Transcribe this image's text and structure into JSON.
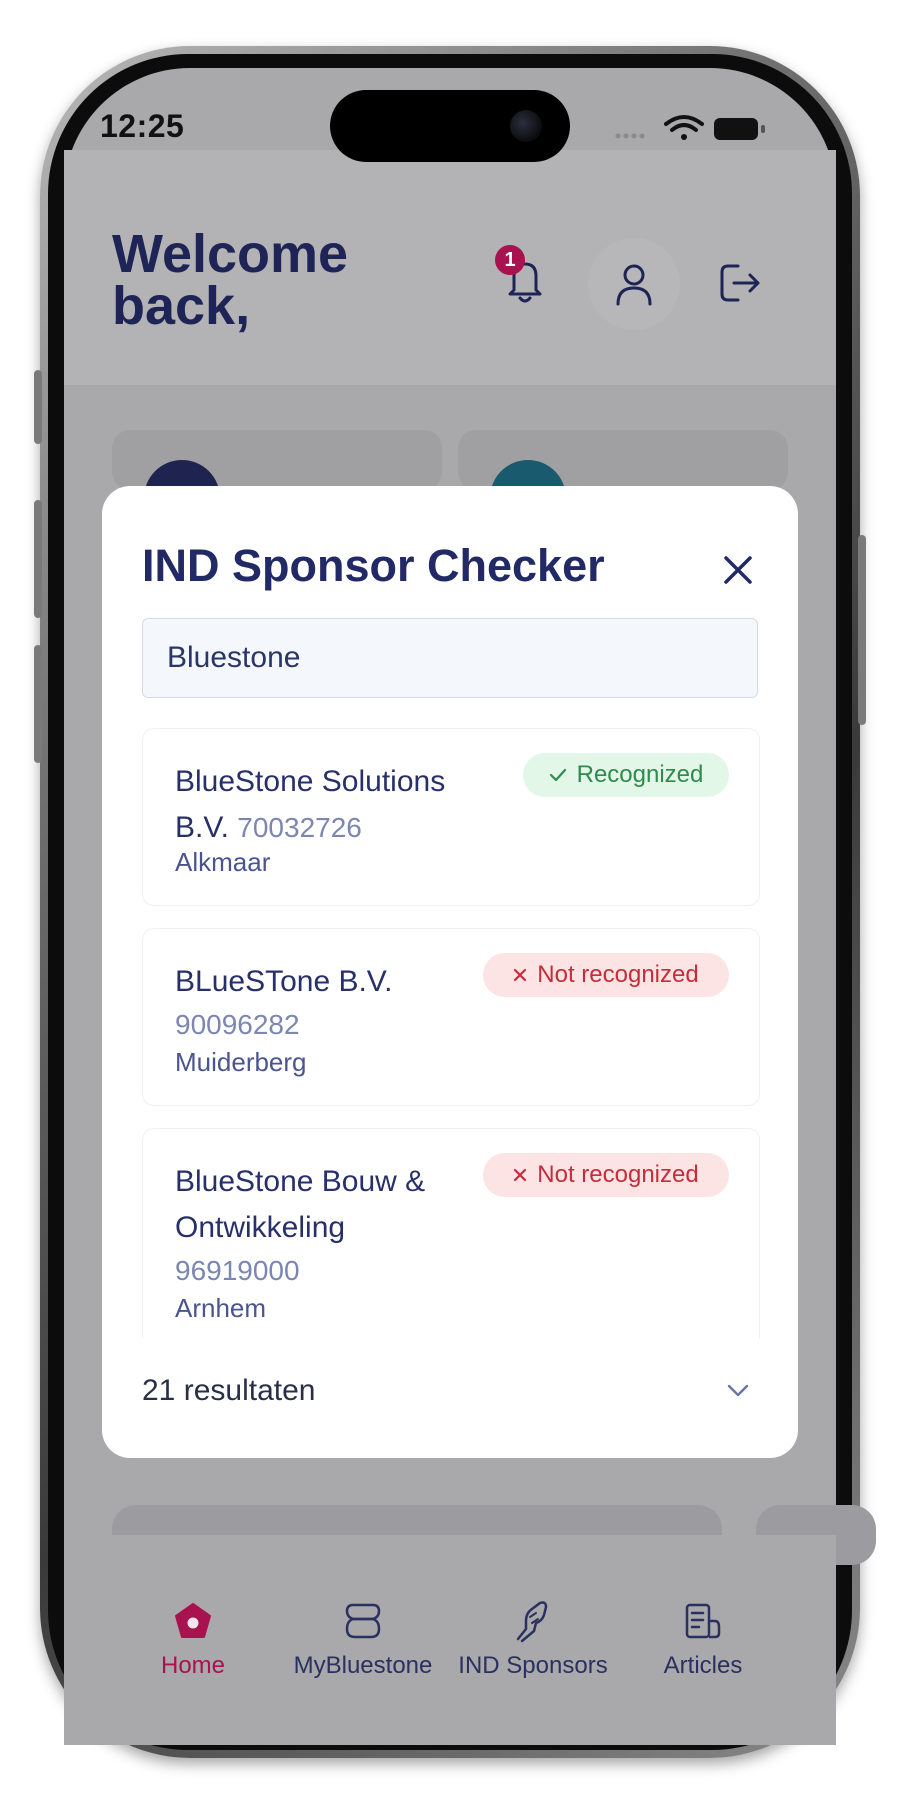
{
  "status_bar": {
    "time": "12:25"
  },
  "home": {
    "welcome_text": "Welcome back,",
    "notification_count": "1"
  },
  "modal": {
    "title": "IND Sponsor Checker",
    "search_value": "Bluestone",
    "results": [
      {
        "name": "BlueStone Solutions B.V.",
        "kvk": "70032726",
        "city": "Alkmaar",
        "status": "Recognized"
      },
      {
        "name": "BLueSTone B.V.",
        "kvk": "90096282",
        "city": "Muiderberg",
        "status": "Not recognized"
      },
      {
        "name": "BlueStone Bouw & Ontwikkeling",
        "kvk": "96919000",
        "city": "Arnhem",
        "status": "Not recognized"
      }
    ],
    "results_count": "21 resultaten"
  },
  "tabbar": {
    "items": [
      {
        "label": "Home",
        "icon": "home-icon",
        "active": true
      },
      {
        "label": "MyBluestone",
        "icon": "bluestone-logo-icon",
        "active": false
      },
      {
        "label": "IND Sponsors",
        "icon": "sponsor-icon",
        "active": false
      },
      {
        "label": "Articles",
        "icon": "articles-icon",
        "active": false
      }
    ]
  },
  "colors": {
    "primary_navy": "#222a66",
    "accent_magenta": "#a8124f",
    "recognized_green": "#2f8a4e",
    "not_recognized_red": "#c62c3a"
  }
}
